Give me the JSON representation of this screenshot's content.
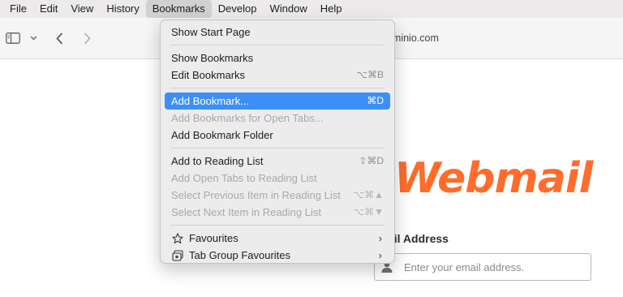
{
  "menubar": {
    "items": [
      "File",
      "Edit",
      "View",
      "History",
      "Bookmarks",
      "Develop",
      "Window",
      "Help"
    ],
    "open_index": 4
  },
  "toolbar": {
    "icons": [
      "sidebar-icon",
      "chevron-down-icon",
      "back-icon",
      "forward-icon"
    ],
    "address": "dominio.com",
    "address_icon": "lock-icon"
  },
  "menu": {
    "groups": [
      [
        {
          "label": "Show Start Page",
          "shortcut": "",
          "enabled": true
        }
      ],
      [
        {
          "label": "Show Bookmarks",
          "shortcut": "",
          "enabled": true
        },
        {
          "label": "Edit Bookmarks",
          "shortcut": "⌥⌘B",
          "enabled": true
        }
      ],
      [
        {
          "label": "Add Bookmark...",
          "shortcut": "⌘D",
          "enabled": true,
          "selected": true
        },
        {
          "label": "Add Bookmarks for Open Tabs...",
          "shortcut": "",
          "enabled": false
        },
        {
          "label": "Add Bookmark Folder",
          "shortcut": "",
          "enabled": true
        }
      ],
      [
        {
          "label": "Add to Reading List",
          "shortcut": "⇧⌘D",
          "enabled": true
        },
        {
          "label": "Add Open Tabs to Reading List",
          "shortcut": "",
          "enabled": false
        },
        {
          "label": "Select Previous Item in Reading List",
          "shortcut": "⌥⌘▲",
          "enabled": false
        },
        {
          "label": "Select Next Item in Reading List",
          "shortcut": "⌥⌘▼",
          "enabled": false
        }
      ],
      [
        {
          "label": "Favourites",
          "icon": "star-icon",
          "submenu": true,
          "enabled": true
        },
        {
          "label": "Tab Group Favourites",
          "icon": "tab-group-icon",
          "submenu": true,
          "enabled": true
        }
      ]
    ]
  },
  "page": {
    "logo_text": "Webmail",
    "email_label": "ail Address",
    "email_placeholder": "Enter your email address.",
    "accent_color": "#ff6c2c"
  }
}
